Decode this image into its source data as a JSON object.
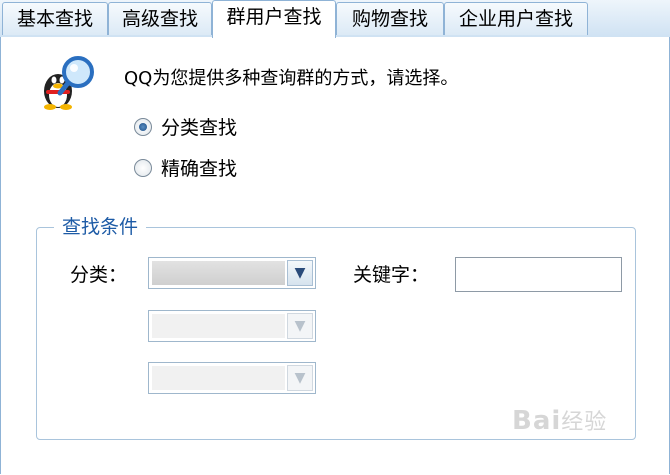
{
  "tabs": [
    {
      "label": "基本查找",
      "active": false
    },
    {
      "label": "高级查找",
      "active": false
    },
    {
      "label": "群用户查找",
      "active": true
    },
    {
      "label": "购物查找",
      "active": false
    },
    {
      "label": "企业用户查找",
      "active": false
    }
  ],
  "intro_text": "QQ为您提供多种查询群的方式，请选择。",
  "search_modes": [
    {
      "label": "分类查找",
      "checked": true
    },
    {
      "label": "精确查找",
      "checked": false
    }
  ],
  "criteria": {
    "legend": "查找条件",
    "category_label": "分类：",
    "keyword_label": "关键字：",
    "keyword_value": ""
  },
  "watermark": {
    "brand": "Bai",
    "suffix": "经验"
  },
  "colors": {
    "accent": "#1d5ba6",
    "tab_border": "#8fb3d6"
  }
}
